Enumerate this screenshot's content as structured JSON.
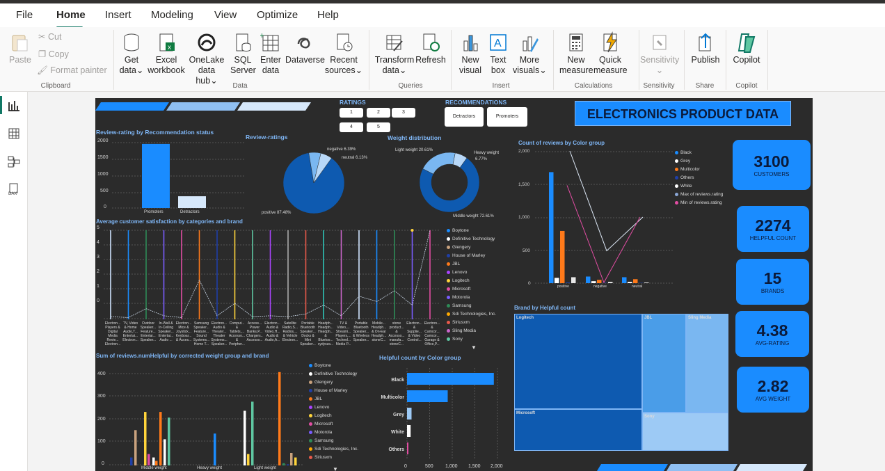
{
  "menu": {
    "file": "File",
    "home": "Home",
    "insert": "Insert",
    "modeling": "Modeling",
    "view": "View",
    "optimize": "Optimize",
    "help": "Help"
  },
  "ribbon": {
    "paste": "Paste",
    "cut": "Cut",
    "copy": "Copy",
    "format_painter": "Format painter",
    "get_data": [
      "Get",
      "data"
    ],
    "excel": [
      "Excel",
      "workbook"
    ],
    "onelake": [
      "OneLake",
      "data hub"
    ],
    "sql": [
      "SQL",
      "Server"
    ],
    "enter": [
      "Enter",
      "data"
    ],
    "dataverse": "Dataverse",
    "recent": [
      "Recent",
      "sources"
    ],
    "transform": [
      "Transform",
      "data"
    ],
    "refresh": "Refresh",
    "new_visual": [
      "New",
      "visual"
    ],
    "text_box": [
      "Text",
      "box"
    ],
    "more_visuals": [
      "More",
      "visuals"
    ],
    "new_measure": [
      "New",
      "measure"
    ],
    "quick_measure": [
      "Quick",
      "measure"
    ],
    "sensitivity": "Sensitivity",
    "publish": "Publish",
    "copilot": "Copilot",
    "groups": {
      "clipboard": "Clipboard",
      "data": "Data",
      "queries": "Queries",
      "insert": "Insert",
      "calculations": "Calculations",
      "sensitivity": "Sensitivity",
      "share": "Share",
      "copilot": "Copilot"
    }
  },
  "report": {
    "title": "ELECTRONICS PRODUCT DATA",
    "ratings_label": "RATINGS",
    "ratings": [
      "1",
      "2",
      "3",
      "4",
      "5"
    ],
    "recs_label": "RECOMMENDATIONS",
    "recs": [
      "Detractors",
      "Promoters"
    ],
    "kpis": [
      {
        "value": "3100",
        "label": "CUSTOMERS"
      },
      {
        "value": "2274",
        "label": "HELPFUL COUNT"
      },
      {
        "value": "15",
        "label": "BRANDS"
      },
      {
        "value": "4.38",
        "label": "AVG-RATING"
      },
      {
        "value": "2.82",
        "label": "AVG WEIGHT"
      }
    ],
    "v1": {
      "title": "Review-rating by Recommendation status",
      "yticks": [
        "2000",
        "1500",
        "1000",
        "500",
        "0"
      ],
      "cats": [
        "Promoters",
        "Detractors"
      ]
    },
    "v2": {
      "title": "Review-ratings",
      "labels": {
        "negative": "negative 6.39%",
        "neutral": "neutral 6.13%",
        "positive": "positive 87.48%"
      }
    },
    "v3": {
      "title": "Weight distribution",
      "labels": {
        "light": "Light weight 20.61%",
        "heavy": "Heavy weight",
        "heavy_pct": "6.77%",
        "middle": "Middle weight 72.61%"
      }
    },
    "v4": {
      "title": "Count of reviews by Color group",
      "yticks": [
        "2,000",
        "1,500",
        "1,000",
        "500",
        "0"
      ],
      "xcats": [
        "positive",
        "negative",
        "neutral"
      ],
      "legend": [
        "Black",
        "Grey",
        "Multicolor",
        "Others",
        "White",
        "Max of reviews.rating",
        "Min of reviews.rating"
      ]
    },
    "v5": {
      "title": "Average customer satisfaction by categories and brand",
      "yticks": [
        "5",
        "4",
        "3",
        "2",
        "1",
        "0"
      ],
      "xcats": [
        "Electron... Players & Digital Media Revie... Electron...",
        "TV, Video & Home Audio,T... Entertai... Electron...",
        "Outdoor Speaker... Feature... Entertai... Speaker...",
        "In-Wall & In-Ceiling Speaker... Entertai... Audio ...",
        "Electron... Mice & Joystick... Keyboar... & Acces...",
        "Samsung Speaker... Feature... Sound Systems... Home T...",
        "Electron... Audio & Theater... Theater Systems... Speaker...",
        "Comput... & Tablets,... Accesso... & Peripher...",
        "Access... Power Banks,P... Chargers... Accesso...",
        "Electron... Audio & Video,H... Audio & Audio,A...",
        "Satellite Radio,S... Radios,... & Vehicle Electron...",
        "Portable Bluetooth Speaker... Docks & Mini Speaker...",
        "Headph... Headph... Headph... & Bluetoo... xydysza...",
        "TV & Video,... Streami... Players,... Technol... Media P...",
        "Portable Bluetooth Speaker... & Wireless Speaker...",
        "Mobile... Headph... & On-Ear Headph... stoneC...",
        "stone product... & Accesso... manufa... stoneC...",
        "Electron... & Supplie... & Video Control...",
        "Electron... & Camcor... Camcor... Garage & Office,P..."
      ],
      "legend": [
        "Boytone",
        "Definitive Technology",
        "Glengery",
        "House of Marley",
        "JBL",
        "Lenovo",
        "Logitech",
        "Microsoft",
        "Motorola",
        "Samsung",
        "Sdi Technologies, Inc.",
        "Siriusxm",
        "Sling Media",
        "Sony"
      ]
    },
    "v6": {
      "title": "Sum of reviews.numHelpful by corrected weight group and brand",
      "yticks": [
        "400",
        "300",
        "200",
        "100",
        "0"
      ],
      "xcats": [
        "Middle weight",
        "Heavy weight",
        "Light weight"
      ],
      "legend": [
        "Boytone",
        "Definitive Technology",
        "Glengery",
        "House of Marley",
        "JBL",
        "Lenovo",
        "Logitech",
        "Microsoft",
        "Motorola",
        "Samsung",
        "Sdi Technologies, Inc.",
        "Siriusxm"
      ]
    },
    "v7": {
      "title": "Helpful count by Color group",
      "cats": [
        "Black",
        "Multicolor",
        "Grey",
        "White",
        "Others"
      ],
      "xticks": [
        "0",
        "500",
        "1,000",
        "1,500",
        "2,000"
      ]
    },
    "v8": {
      "title": "Brand by Helpful count",
      "brands": [
        "Logitech",
        "JBL",
        "Sling Media",
        "Microsoft",
        "Sony"
      ]
    }
  },
  "chart_data": [
    {
      "type": "bar",
      "title": "Review-rating by Recommendation status",
      "categories": [
        "Promoters",
        "Detractors"
      ],
      "values": [
        1960,
        360
      ],
      "ylim": [
        0,
        2000
      ]
    },
    {
      "type": "pie",
      "title": "Review-ratings",
      "categories": [
        "positive",
        "negative",
        "neutral"
      ],
      "values": [
        87.48,
        6.39,
        6.13
      ]
    },
    {
      "type": "pie",
      "title": "Weight distribution",
      "categories": [
        "Middle weight",
        "Light weight",
        "Heavy weight"
      ],
      "values": [
        72.61,
        20.61,
        6.77
      ]
    },
    {
      "type": "bar",
      "title": "Count of reviews by Color group",
      "categories": [
        "positive",
        "negative",
        "neutral"
      ],
      "series": [
        {
          "name": "Black",
          "values": [
            1680,
            100,
            90
          ]
        },
        {
          "name": "Grey",
          "values": [
            80,
            30,
            20
          ]
        },
        {
          "name": "Multicolor",
          "values": [
            790,
            50,
            60
          ]
        },
        {
          "name": "Others",
          "values": [
            10,
            5,
            5
          ]
        },
        {
          "name": "White",
          "values": [
            90,
            20,
            10
          ]
        }
      ],
      "lines": [
        {
          "name": "Max of reviews.rating",
          "values": [
            2000,
            490,
            1000
          ]
        },
        {
          "name": "Min of reviews.rating",
          "values": [
            1480,
            10,
            1000
          ]
        }
      ],
      "ylim": [
        0,
        2000
      ]
    },
    {
      "type": "bar",
      "title": "Helpful count by Color group",
      "categories": [
        "Black",
        "Multicolor",
        "Grey",
        "White",
        "Others"
      ],
      "values": [
        1920,
        900,
        100,
        80,
        30
      ],
      "xlim": [
        0,
        2000
      ]
    },
    {
      "type": "heatmap",
      "title": "Brand by Helpful count",
      "categories": [
        "Logitech",
        "JBL",
        "Sling Media",
        "Microsoft",
        "Sony"
      ],
      "values": [
        850,
        290,
        280,
        600,
        450
      ]
    }
  ]
}
